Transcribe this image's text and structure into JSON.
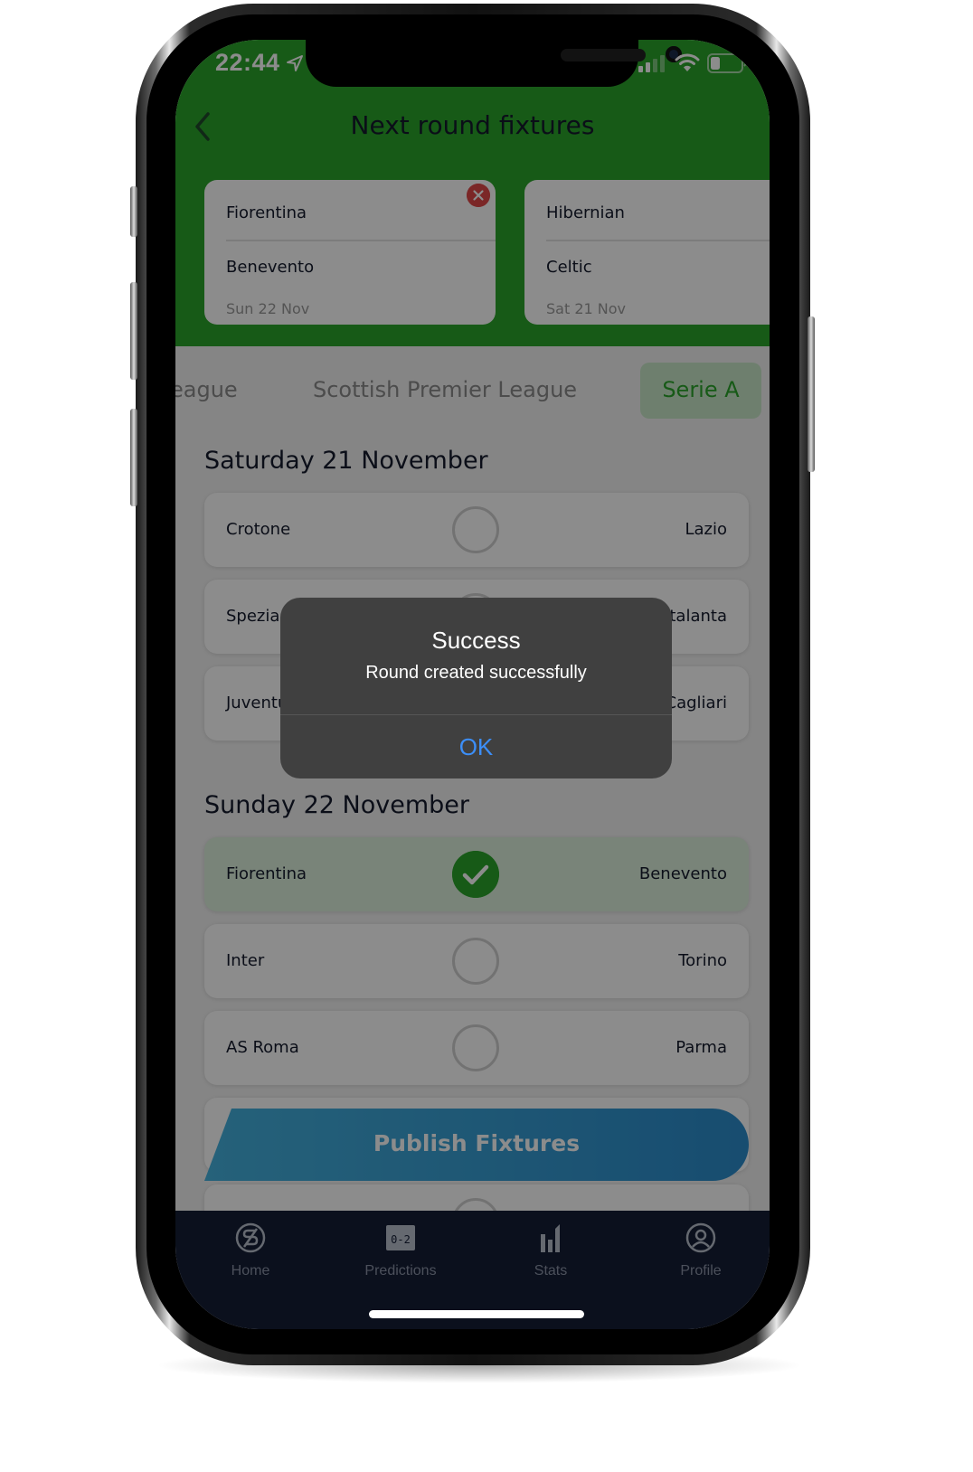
{
  "status_bar": {
    "time": "22:44",
    "icons": [
      "location-arrow-icon",
      "cellular-signal-icon",
      "wifi-icon",
      "battery-icon"
    ]
  },
  "header": {
    "title": "Next round fixtures",
    "back_icon": "chevron-left-icon"
  },
  "selected_fixtures": [
    {
      "home": "Fiorentina",
      "away": "Benevento",
      "date": "Sun 22 Nov",
      "removable": true
    },
    {
      "home": "Hibernian",
      "away": "Celtic",
      "date": "Sat 21 Nov",
      "removable": false
    }
  ],
  "league_tabs": {
    "items": [
      "eague",
      "Scottish Premier League",
      "Serie A"
    ],
    "active": "Serie A"
  },
  "days": [
    {
      "heading": "Saturday 21 November",
      "matches": [
        {
          "home": "Crotone",
          "away": "Lazio",
          "selected": false
        },
        {
          "home": "Spezia",
          "away": "Atalanta",
          "selected": false
        },
        {
          "home": "Juventus",
          "away": "Cagliari",
          "selected": false
        }
      ]
    },
    {
      "heading": "Sunday 22 November",
      "matches": [
        {
          "home": "Fiorentina",
          "away": "Benevento",
          "selected": true
        },
        {
          "home": "Inter",
          "away": "Torino",
          "selected": false
        },
        {
          "home": "AS Roma",
          "away": "Parma",
          "selected": false
        }
      ]
    }
  ],
  "publish_button": {
    "label": "Publish Fixtures"
  },
  "nav": {
    "items": [
      {
        "label": "Home",
        "icon": "home-logo-icon"
      },
      {
        "label": "Predictions",
        "icon": "scoreboard-icon"
      },
      {
        "label": "Stats",
        "icon": "bar-chart-icon"
      },
      {
        "label": "Profile",
        "icon": "user-circle-icon"
      }
    ]
  },
  "alert": {
    "title": "Success",
    "message": "Round created successfully",
    "ok_label": "OK"
  },
  "colors": {
    "brand_green": "#2aa52a",
    "navbar_bg": "#141e36",
    "publish_gradient_start": "#45b2de",
    "publish_gradient_end": "#2b8ccc",
    "remove_red": "#e04848",
    "alert_link_blue": "#3c8ef7"
  }
}
